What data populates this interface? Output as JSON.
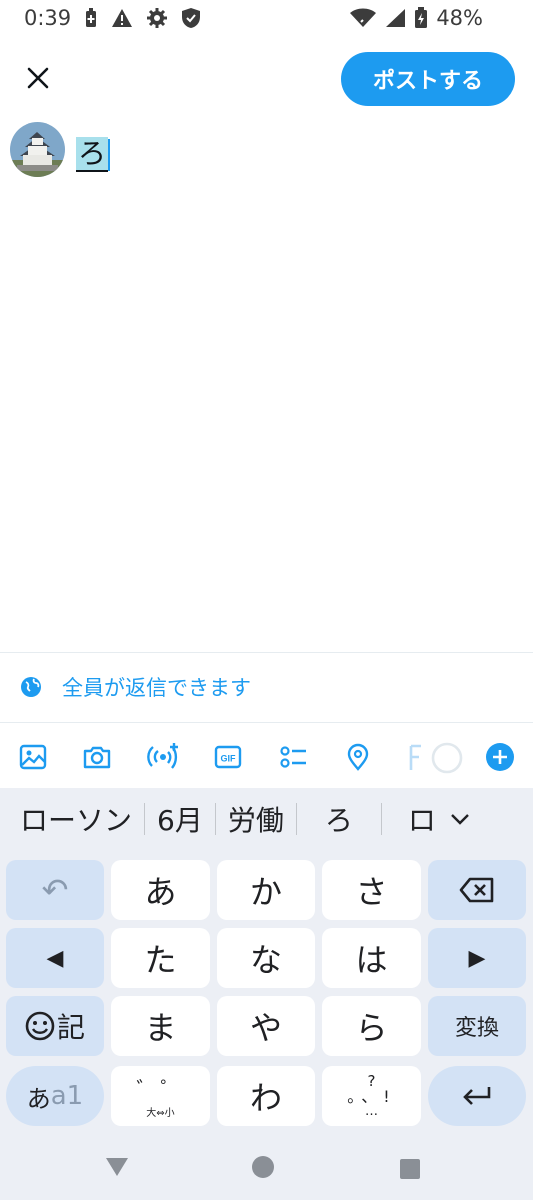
{
  "status_bar": {
    "time": "0:39",
    "battery": "48%",
    "icons": [
      "battery-saver-icon",
      "warning-icon",
      "settings-gear-icon",
      "shield-icon",
      "wifi-icon",
      "signal-icon",
      "battery-icon"
    ]
  },
  "header": {
    "close_icon": "close-icon",
    "post_label": "ポストする"
  },
  "compose": {
    "text": "ろ"
  },
  "reply_setting": {
    "icon": "globe-icon",
    "label": "全員が返信できます"
  },
  "toolbar": {
    "items": [
      "image-icon",
      "camera-icon",
      "voice-space-icon",
      "gif-icon",
      "poll-icon",
      "location-icon",
      "char-counter",
      "add-icon"
    ],
    "gif_label": "GIF"
  },
  "keyboard": {
    "suggestions": [
      "ローソン",
      "6月",
      "労働",
      "ろ",
      "ロ"
    ],
    "keys": {
      "undo": "↶",
      "a": "あ",
      "ka": "か",
      "sa": "さ",
      "left": "◀",
      "ta": "た",
      "na": "な",
      "ha": "は",
      "right": "▶",
      "emoji_label": "記",
      "ma": "ま",
      "ya": "や",
      "ra": "ら",
      "henkan": "変換",
      "mode_a": "あ",
      "mode_a1": "a1",
      "dakuten_label": "゛゜",
      "dakuten_sub": "大⇔小",
      "wa": "わ",
      "punct_top": "?",
      "punct_mid": "。、!",
      "punct_bottom": "…",
      "enter": "↵"
    }
  },
  "colors": {
    "accent": "#1d9bf0",
    "keyboard_bg": "#eceff5",
    "key_blue": "#d3e2f5",
    "highlight": "#a8e0ec"
  }
}
